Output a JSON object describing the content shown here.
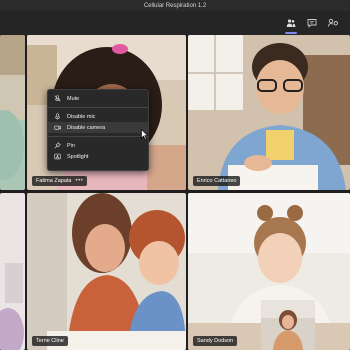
{
  "window": {
    "title": "Cellular Respiration 1.2"
  },
  "toolbar": {
    "buttons": [
      {
        "icon": "participants-icon",
        "active": true
      },
      {
        "icon": "chat-icon",
        "active": false
      },
      {
        "icon": "share-tray-icon",
        "active": false
      }
    ],
    "accent_color": "#7f85f5"
  },
  "participants": [
    {
      "name": "Fatima Zapata",
      "has_more": true
    },
    {
      "name": "Enrico Cattaneo",
      "has_more": false
    },
    {
      "name": "Terrie Cline",
      "has_more": false
    },
    {
      "name": "Sandy Dodson",
      "has_more": false
    }
  ],
  "more_symbol": "•••",
  "context_menu": {
    "items": [
      {
        "label": "Mute",
        "icon": "mic-off-icon"
      },
      {
        "label": "Disable mic",
        "icon": "mic-disable-icon"
      },
      {
        "label": "Disable camera",
        "icon": "camera-disable-icon"
      },
      {
        "label": "Pin",
        "icon": "pin-icon"
      },
      {
        "label": "Spotlight",
        "icon": "spotlight-icon"
      }
    ],
    "hovered": "Disable camera"
  }
}
